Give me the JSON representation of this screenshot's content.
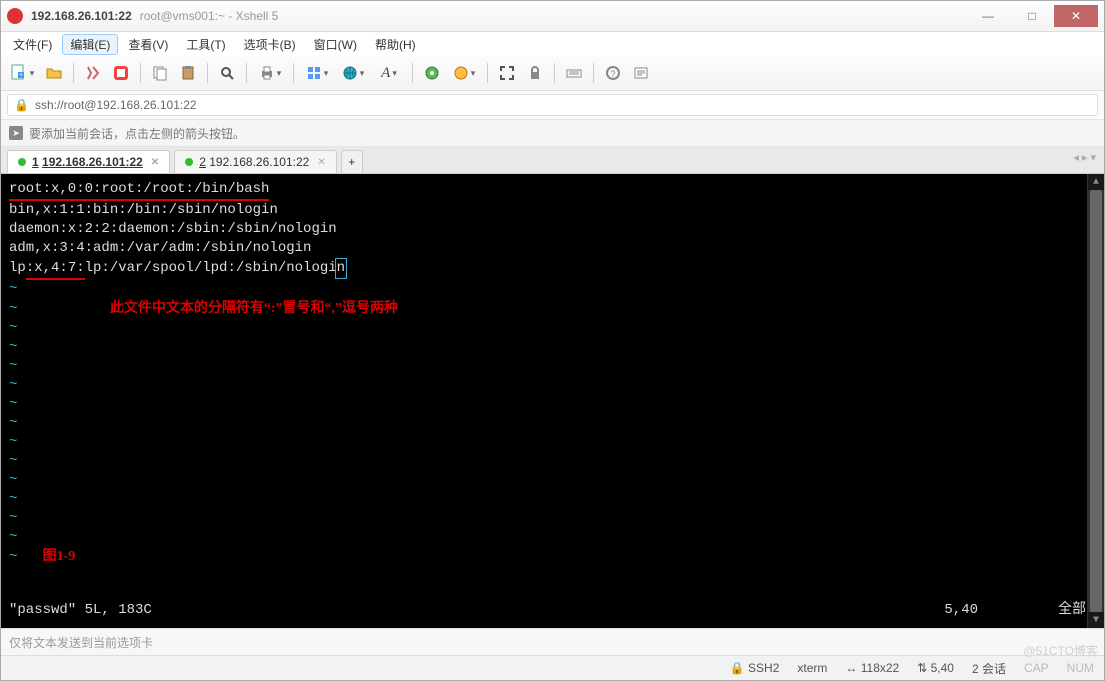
{
  "titlebar": {
    "main": "192.168.26.101:22",
    "sub": "root@vms001:~ - Xshell 5"
  },
  "menu": {
    "items": [
      "文件(F)",
      "编辑(E)",
      "查看(V)",
      "工具(T)",
      "选项卡(B)",
      "窗口(W)",
      "帮助(H)"
    ],
    "active_index": 1
  },
  "toolbar": {
    "icons": [
      "new-session-icon",
      "open-icon",
      "disconnect-icon",
      "quickcmd-icon",
      "copy-icon",
      "paste-icon",
      "find-icon",
      "print-icon",
      "properties-icon",
      "globe-icon",
      "font-icon",
      "colors-icon",
      "translate-icon",
      "fullscreen-icon",
      "lock-icon",
      "keyboard-icon",
      "compose-icon"
    ]
  },
  "address": {
    "url": "ssh://root@192.168.26.101:22"
  },
  "hint": {
    "text": "要添加当前会话，点击左侧的箭头按钮。"
  },
  "tabs": {
    "items": [
      {
        "num": "1",
        "label": "192.168.26.101:22",
        "active": true
      },
      {
        "num": "2",
        "label": "192.168.26.101:22",
        "active": false
      }
    ],
    "add": "+"
  },
  "terminal": {
    "lines": [
      "root:x,0:0:root:/root:/bin/bash",
      "bin,x:1:1:bin:/bin:/sbin/nologin",
      "daemon:x:2:2:daemon:/sbin:/sbin/nologin",
      "adm,x:3:4:adm:/var/adm:/sbin/nologin",
      "lp:x,4:7:lp:/var/spool/lpd:/sbin/nologin"
    ],
    "underline_line0": "root:x,0:0:root:/root:/bin/bash",
    "underline_line4_a": ":x,4:7:",
    "cursor_char": "n",
    "tilde_count": 14,
    "annotation": "此文件中文本的分隔符有“:”冒号和“,”逗号两种",
    "figure_label": "图1-9",
    "status_left": "\"passwd\" 5L, 183C",
    "status_pos": "5,40",
    "status_right": "全部"
  },
  "sendbar": {
    "placeholder": "仅将文本发送到当前选项卡"
  },
  "status": {
    "proto": "SSH2",
    "term": "xterm",
    "size": "118x22",
    "cursor": "5,40",
    "sessions": "2 会话",
    "caps": "CAP",
    "num": "NUM"
  },
  "watermark": {
    "l1": "@51CTO博客",
    "l2": ""
  }
}
